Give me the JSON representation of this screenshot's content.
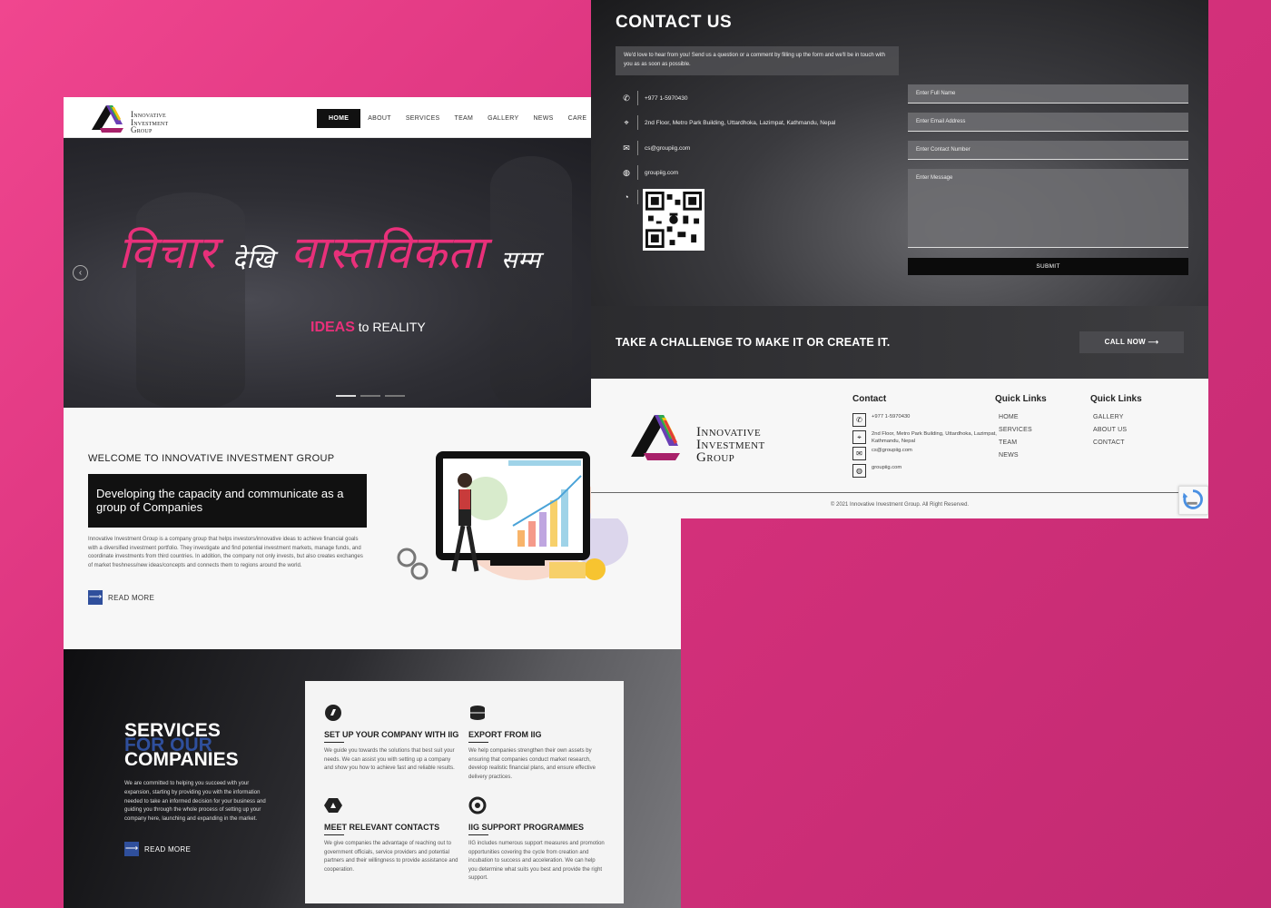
{
  "left": {
    "logo_text": [
      "Innovative",
      "Investment",
      "Group"
    ],
    "menu": [
      "HOME",
      "ABOUT",
      "SERVICES",
      "TEAM",
      "GALLERY",
      "NEWS",
      "CARE"
    ],
    "hero": {
      "devanagari": [
        "विचार",
        "देखि",
        "वास्तविकता",
        "सम्म"
      ],
      "tagline_ideas": "IDEAS",
      "tagline_rest": "to REALITY",
      "prev_arrow": "‹"
    },
    "welcome": {
      "title": "WELCOME TO INNOVATIVE INVESTMENT GROUP",
      "box_text": "Developing the capacity and communicate as a group of Companies",
      "paragraph": "Innovative Investment Group is a company group that helps investors/innovative ideas to achieve financial goals with a diversified investment portfolio. They investigate and find potential investment markets, manage funds, and coordinate investments from third countries. In addition, the company not only invests, but also creates exchanges of market freshness/new ideas/concepts and connects them to regions around the world.",
      "read_more": "READ MORE"
    },
    "services": {
      "heading_1": "SERVICES",
      "heading_2": "FOR OUR",
      "heading_3": "COMPANIES",
      "paragraph": "We are committed to helping you succeed with your expansion, starting by providing you with the information needed to take an informed decision for your business and guiding you through the whole process of setting up your company here, launching and expanding in the market.",
      "read_more": "READ MORE",
      "cards": [
        {
          "title": "SET UP YOUR COMPANY WITH IIG",
          "text": "We guide you towards the solutions that best suit your needs. We can assist you with setting up a company and show you how to achieve fast and reliable results."
        },
        {
          "title": "EXPORT FROM IIG",
          "text": "We help companies strengthen their own assets by ensuring that companies conduct market research, develop realistic financial plans, and ensure effective delivery practices."
        },
        {
          "title": "MEET RELEVANT CONTACTS",
          "text": "We give companies the advantage of reaching out to government officials, service providers and potential partners and their willingness to provide assistance and cooperation."
        },
        {
          "title": "IIG SUPPORT PROGRAMMES",
          "text": "IIG includes numerous support measures and promotion opportunities covering the cycle from creation and incubation to success and acceleration. We can help you determine what suits you best and provide the right support."
        }
      ]
    }
  },
  "right": {
    "contact_title": "CONTACT US",
    "intro": "We'd love to hear from you! Send us a question or a comment by filling up the form and we'll be in touch with you as as soon as possible.",
    "phone": "+977 1-5970430",
    "address": "2nd Floor, Metro Park Building, Uttardhoka, Lazimpat, Kathmandu, Nepal",
    "email": "cs@groupiig.com",
    "website": "groupiig.com",
    "form": {
      "name_ph": "Enter Full Name",
      "email_ph": "Enter Email Address",
      "contact_ph": "Enter Contact Number",
      "message_ph": "Enter Message",
      "submit": "SUBMIT"
    },
    "cta_text": "TAKE A CHALLENGE TO MAKE IT OR CREATE IT.",
    "call_now": "CALL NOW",
    "footer": {
      "logo_text": [
        "Innovative",
        "Investment",
        "Group"
      ],
      "contact_title": "Contact",
      "phone": "+977 1-5970430",
      "address": "2nd Floor, Metro Park Building, Uttardhoka, Lazimpat, Kathmandu, Nepal",
      "email": "cs@groupiig.com",
      "website": "groupiig.com",
      "quick_links_title": "Quick Links",
      "links_1": [
        "HOME",
        "SERVICES",
        "TEAM",
        "NEWS"
      ],
      "links_2": [
        "GALLERY",
        "ABOUT US",
        "CONTACT"
      ],
      "copyright": "© 2021 Innovative Investment Group. All Right Reserved."
    }
  },
  "colors": {
    "pink": "#e8307a",
    "blue": "#2f4f9c",
    "dark": "#111111"
  },
  "icons": [
    "phone-icon",
    "location-icon",
    "mail-icon",
    "globe-icon",
    "whatsapp-icon",
    "arrow-right-icon",
    "chevron-left-icon"
  ]
}
